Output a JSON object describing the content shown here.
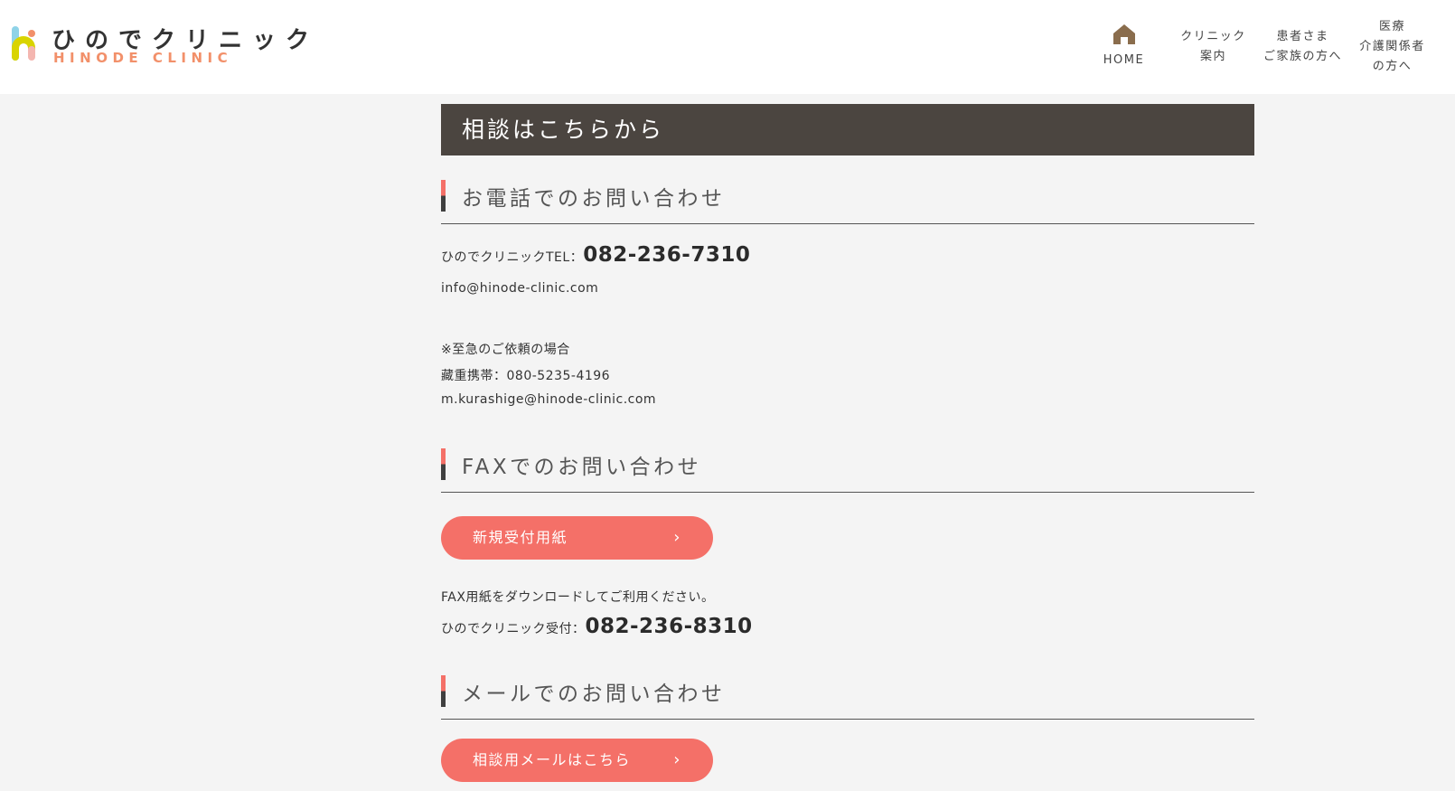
{
  "header": {
    "logo_ja": "ひのでクリニック",
    "logo_en": "HINODE CLINIC",
    "nav": [
      {
        "lines": [
          "HOME"
        ]
      },
      {
        "lines": [
          "クリニック",
          "案内"
        ]
      },
      {
        "lines": [
          "患者さま",
          "ご家族の方へ"
        ]
      },
      {
        "lines": [
          "医療",
          "介護関係者",
          "の方へ"
        ]
      }
    ]
  },
  "main": {
    "title": "相談はこちらから",
    "phone": {
      "heading": "お電話でのお問い合わせ",
      "tel_label": "ひのでクリニックTEL：",
      "tel_number": "082-236-7310",
      "email": "info@hinode-clinic.com",
      "urgent_note": "※至急のご依頼の場合",
      "mobile": "藏重携帯：080-5235-4196",
      "mobile_email": "m.kurashige@hinode-clinic.com"
    },
    "fax": {
      "heading": "FAXでのお問い合わせ",
      "button_label": "新規受付用紙",
      "note": "FAX用紙をダウンロードしてご利用ください。",
      "reception_label": "ひのでクリニック受付：",
      "reception_number": "082-236-8310"
    },
    "mail": {
      "heading": "メールでのお問い合わせ",
      "button_label": "相談用メールはこちら"
    }
  },
  "colors": {
    "accent": "#f47068",
    "banner": "#4b4540",
    "logo_en": "#f2906a"
  }
}
